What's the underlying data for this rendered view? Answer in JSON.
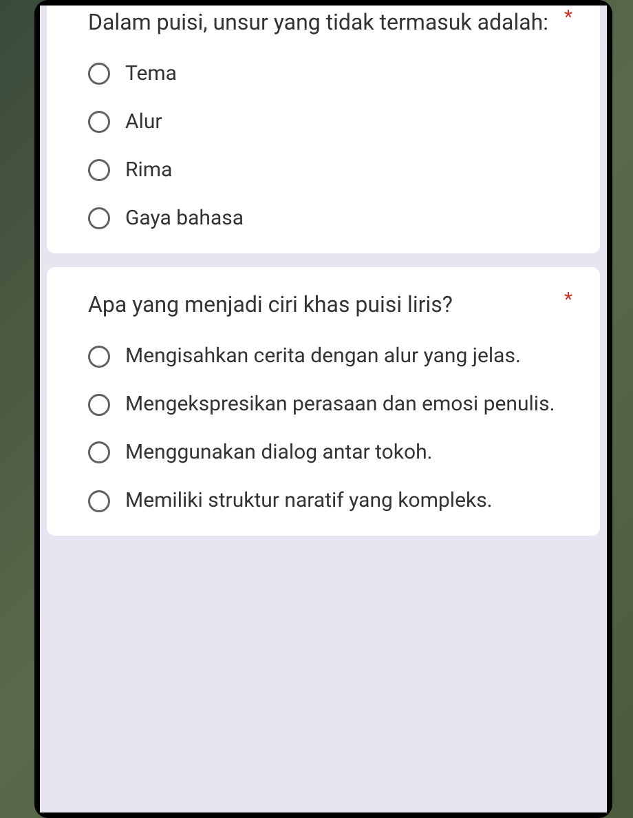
{
  "questions": [
    {
      "text": "Dalam puisi, unsur yang tidak termasuk adalah:",
      "required": "*",
      "options": [
        "Tema",
        "Alur",
        "Rima",
        "Gaya bahasa"
      ]
    },
    {
      "text": "Apa yang menjadi ciri khas puisi liris?",
      "required": "*",
      "options": [
        "Mengisahkan cerita dengan alur yang jelas.",
        "Mengekspresikan perasaan dan emosi penulis.",
        "Menggunakan dialog antar tokoh.",
        "Memiliki struktur naratif yang kompleks."
      ]
    }
  ]
}
